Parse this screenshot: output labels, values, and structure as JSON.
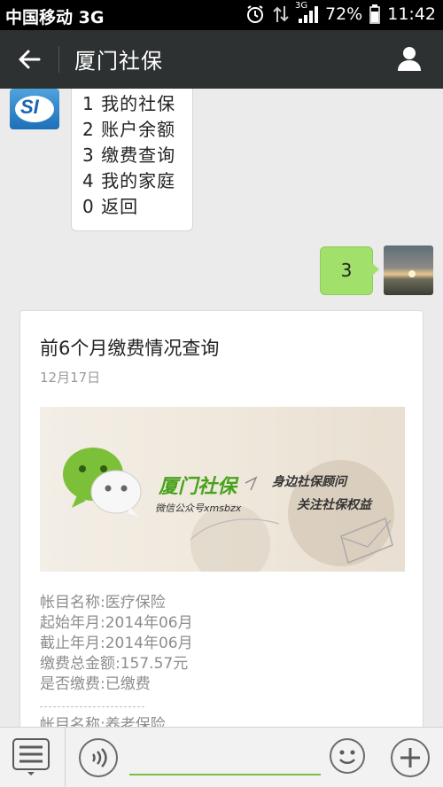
{
  "status_bar": {
    "carrier": "中国移动 3G",
    "network": "3G",
    "battery": "72%",
    "time": "11:42"
  },
  "header": {
    "title": "厦门社保"
  },
  "chat": {
    "bot_avatar_text": "SI",
    "menu_items": [
      {
        "label": "1 我的社保"
      },
      {
        "label": "2 账户余额"
      },
      {
        "label": "3 缴费查询"
      },
      {
        "label": "4 我的家庭"
      },
      {
        "label": "0 返回"
      }
    ],
    "user_reply": "3",
    "article": {
      "title": "前6个月缴费情况查询",
      "date": "12月17日",
      "banner": {
        "brand": "厦门社保",
        "account": "微信公众号xmsbzx",
        "slogan_1": "身边社保顾问",
        "slogan_2": "关注社保权益"
      },
      "details": [
        {
          "text": "帐目名称:医疗保险"
        },
        {
          "text": "起始年月:2014年06月"
        },
        {
          "text": "截止年月:2014年06月"
        },
        {
          "text": "缴费总金额:157.57元"
        },
        {
          "text": "是否缴费:已缴费"
        }
      ],
      "next_line": "帐目名称:养老保险"
    }
  },
  "input_bar": {
    "placeholder": ""
  },
  "colors": {
    "header_bg": "#2e3132",
    "reply_bubble": "#a1e06a",
    "accent_green": "#7ac043"
  }
}
